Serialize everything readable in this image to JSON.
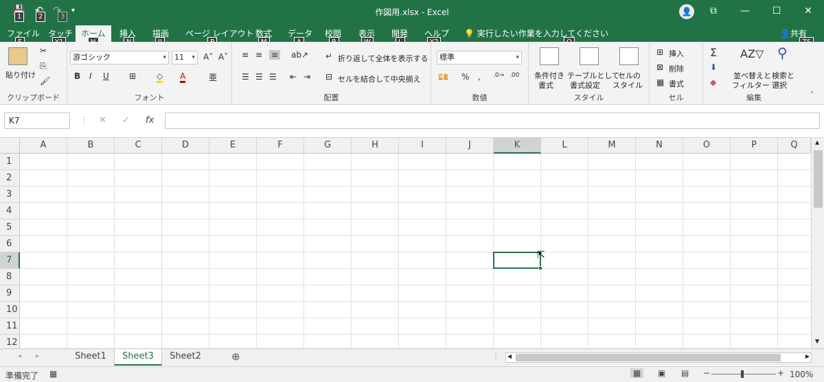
{
  "window": {
    "title": "作図用.xlsx  -  Excel",
    "avatar": "👤"
  },
  "qat": {
    "save": "💾",
    "undo": "↶",
    "redo": "↷",
    "more": "▾",
    "keys": [
      "1",
      "2",
      "3"
    ]
  },
  "tabs": [
    {
      "label": "ファイル",
      "key": "F"
    },
    {
      "label": "タッチ",
      "key": "Y1"
    },
    {
      "label": "ホーム",
      "key": "H"
    },
    {
      "label": "挿入",
      "key": "N"
    },
    {
      "label": "描画",
      "key": "JI"
    },
    {
      "label": "ページ レイアウト",
      "key": "P"
    },
    {
      "label": "数式",
      "key": "M"
    },
    {
      "label": "データ",
      "key": "A"
    },
    {
      "label": "校閲",
      "key": "R"
    },
    {
      "label": "表示",
      "key": "W"
    },
    {
      "label": "開発",
      "key": "L"
    },
    {
      "label": "ヘルプ",
      "key": "Y2"
    }
  ],
  "tellme": {
    "text": "実行したい作業を入力してください",
    "key": "Q"
  },
  "share": {
    "label": "共有",
    "key": "ZS"
  },
  "ribbon": {
    "clipboard": {
      "paste": "貼り付け",
      "label": "クリップボード"
    },
    "font": {
      "name": "游ゴシック",
      "size": "11",
      "bold": "B",
      "italic": "I",
      "underline": "U",
      "label": "フォント"
    },
    "alignment": {
      "wrap": "折り返して全体を表示する",
      "merge": "セルを結合して中央揃え",
      "label": "配置"
    },
    "number": {
      "format": "標準",
      "label": "数値"
    },
    "styles": {
      "cond": "条件付き",
      "cond2": "書式",
      "table": "テーブルとして",
      "table2": "書式設定",
      "cell": "セルの",
      "cell2": "スタイル",
      "label": "スタイル"
    },
    "cells": {
      "insert": "挿入",
      "delete": "削除",
      "format": "書式",
      "label": "セル"
    },
    "editing": {
      "sort": "並べ替えと",
      "sort2": "フィルター",
      "find": "検索と",
      "find2": "選択",
      "label": "編集"
    }
  },
  "formula": {
    "namebox": "K7",
    "value": ""
  },
  "columns": [
    "A",
    "B",
    "C",
    "D",
    "E",
    "F",
    "G",
    "H",
    "I",
    "J",
    "K",
    "L",
    "M",
    "N",
    "O",
    "P",
    "Q"
  ],
  "rows": [
    "1",
    "2",
    "3",
    "4",
    "5",
    "6",
    "7",
    "8",
    "9",
    "10",
    "11",
    "12"
  ],
  "selected": {
    "col": "K",
    "row": "7"
  },
  "sheets": [
    "Sheet1",
    "Sheet3",
    "Sheet2"
  ],
  "active_sheet": "Sheet3",
  "status": {
    "ready": "準備完了",
    "zoom": "100%"
  },
  "colors": {
    "accent": "#217346"
  }
}
